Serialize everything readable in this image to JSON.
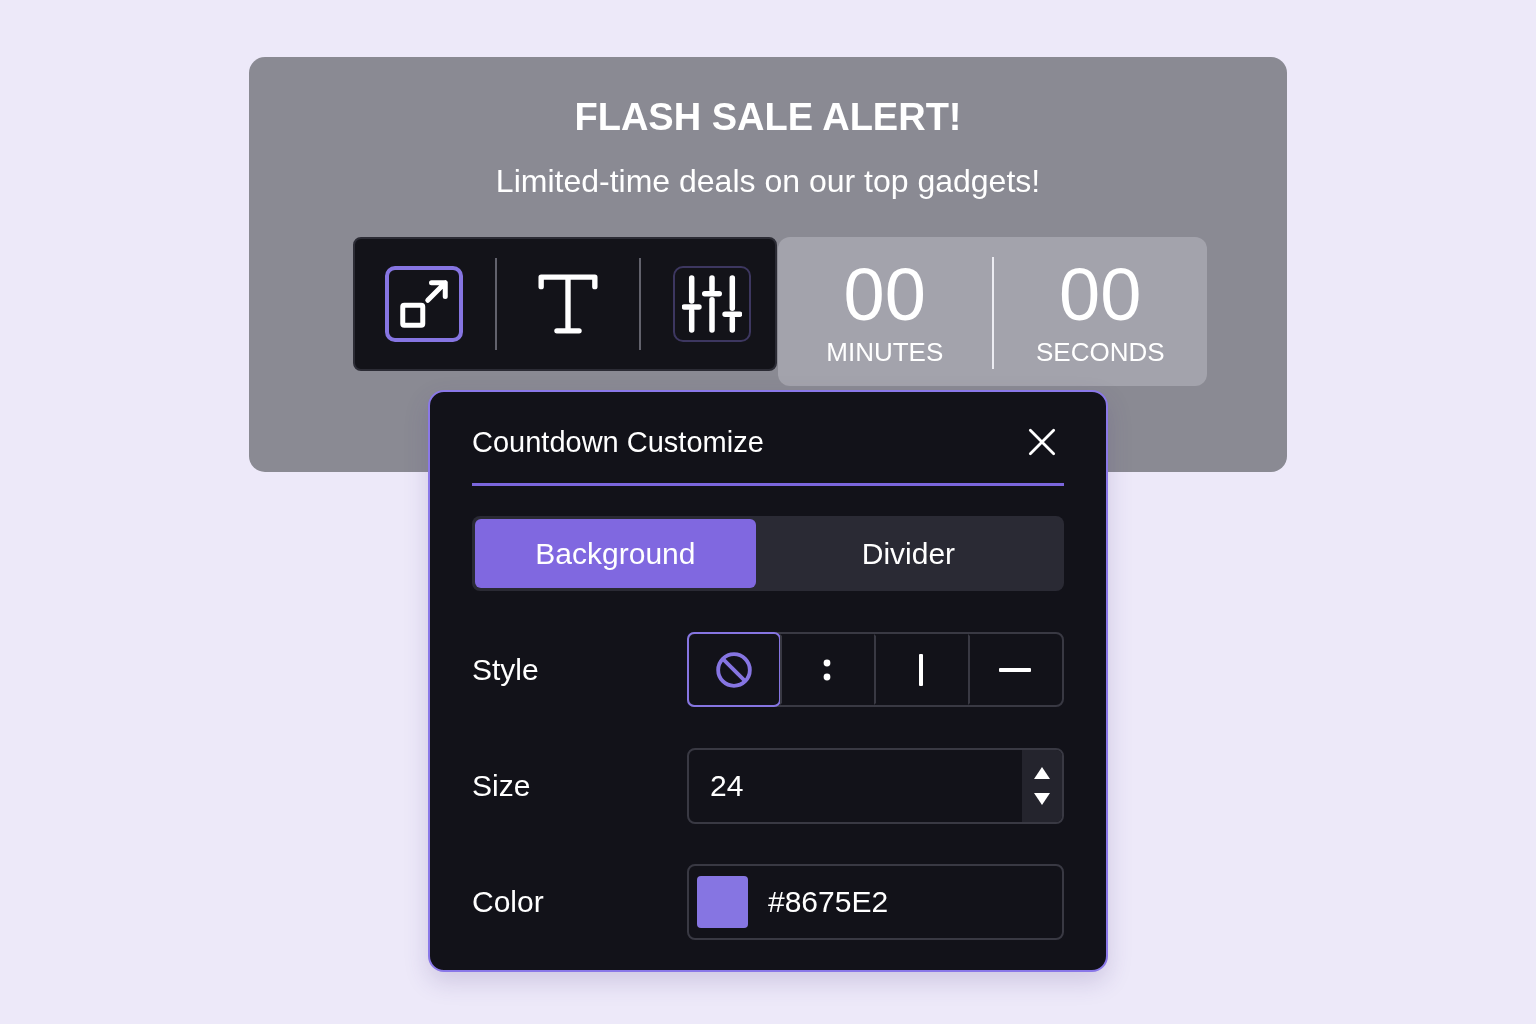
{
  "banner": {
    "title": "FLASH SALE ALERT!",
    "subtitle": "Limited-time deals on our top gadgets!"
  },
  "toolbar": {
    "tools": [
      {
        "kind": "expand",
        "selected": true,
        "hovered": false
      },
      {
        "kind": "text",
        "selected": false,
        "hovered": false
      },
      {
        "kind": "sliders",
        "selected": false,
        "hovered": true
      }
    ]
  },
  "countdown": {
    "units": [
      {
        "value": "00",
        "label": "MINUTES"
      },
      {
        "value": "00",
        "label": "SECONDS"
      }
    ]
  },
  "panel": {
    "title": "Countdown Customize",
    "tabs": [
      {
        "label": "Background",
        "selected": true
      },
      {
        "label": "Divider",
        "selected": false
      }
    ],
    "fields": [
      {
        "kind": "style",
        "label": "Style",
        "options": [
          {
            "kind": "none",
            "selected": true
          },
          {
            "kind": "colon",
            "selected": false
          },
          {
            "kind": "bar",
            "selected": false
          },
          {
            "kind": "dash",
            "selected": false
          }
        ]
      },
      {
        "kind": "number",
        "label": "Size",
        "value": "24"
      },
      {
        "kind": "color",
        "label": "Color",
        "value": "#8675E2",
        "color": "#8675e2"
      }
    ]
  }
}
